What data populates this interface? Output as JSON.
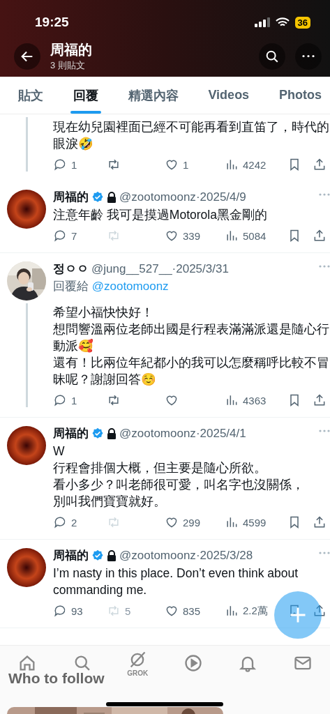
{
  "status_bar": {
    "time": "19:25",
    "battery": "36"
  },
  "header": {
    "title": "周福的",
    "subtitle": "3 則貼文"
  },
  "tabs": [
    {
      "label": "貼文",
      "selected": false
    },
    {
      "label": "回覆",
      "selected": true
    },
    {
      "label": "精選內容",
      "selected": false
    },
    {
      "label": "Videos",
      "selected": false
    },
    {
      "label": "Photos",
      "selected": false
    }
  ],
  "posts": [
    {
      "continued": true,
      "connects_below": false,
      "text": [
        "現在幼兒園裡面已經不可能再看到直笛了，時代的眼淚🤣"
      ],
      "replies": "1",
      "repost_enabled": true,
      "likes": "1",
      "views": "4242"
    },
    {
      "continued": false,
      "connects_below": false,
      "avatar": {
        "kind": "ring"
      },
      "name": "周福的",
      "verified": true,
      "locked": true,
      "handle": "@zootomoonz",
      "date": "·2025/4/9",
      "text": [
        "注意年齡 我可是摸過Motorola黑金剛的"
      ],
      "replies": "7",
      "repost_enabled": false,
      "likes": "339",
      "views": "5084"
    },
    {
      "continued": false,
      "connects_below": true,
      "avatar": {
        "kind": "picture"
      },
      "name": "정ㅇㅇ",
      "verified": false,
      "locked": false,
      "handle": "@jung__527__",
      "date": "·2025/3/31",
      "reply_label": "回覆給",
      "reply_to": "@zootomoonz",
      "text": [
        "希望小福快快好！",
        "想問響溫兩位老師出國是行程表滿滿派還是隨心行動派🥰",
        "還有！比兩位年紀都小的我可以怎麼稱呼比較不冒昧呢？謝謝回答☺️"
      ],
      "replies": "1",
      "repost_enabled": true,
      "views": "4363"
    },
    {
      "continued": false,
      "connects_below": false,
      "avatar": {
        "kind": "ring"
      },
      "name": "周福的",
      "verified": true,
      "locked": true,
      "handle": "@zootomoonz",
      "date": "·2025/4/1",
      "text": [
        "W",
        "行程會排個大概，但主要是隨心所欲。",
        "看小多少？叫老師很可愛，叫名字也沒關係，",
        "別叫我們寶寶就好。"
      ],
      "replies": "2",
      "repost_enabled": false,
      "likes": "299",
      "views": "4599"
    },
    {
      "continued": false,
      "connects_below": false,
      "avatar": {
        "kind": "ring"
      },
      "name": "周福的",
      "verified": true,
      "locked": true,
      "handle": "@zootomoonz",
      "date": "·2025/3/28",
      "text": [
        "I’m nasty in this place. Don’t even think about commanding me."
      ],
      "replies": "93",
      "repost_enabled": false,
      "reposts": "5",
      "likes": "835",
      "views": "2.2萬"
    }
  ],
  "section_title": "Who to follow",
  "nav": {
    "grok_label": "GROK"
  }
}
